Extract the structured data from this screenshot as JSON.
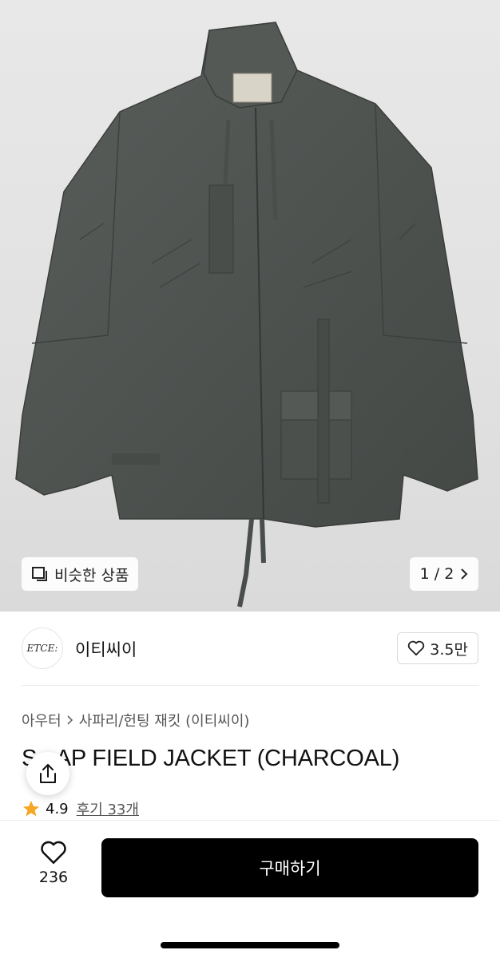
{
  "product_image": {
    "similar_label": "비슷한 상품",
    "pager": "1 / 2"
  },
  "brand": {
    "logo_text": "ETCE:",
    "name": "이티씨이",
    "likes": "3.5만"
  },
  "breadcrumb": {
    "items": [
      "아우터",
      "사파리/헌팅 재킷 (이티씨이)"
    ]
  },
  "product": {
    "title": "S...AP FIELD JACKET (CHARCOAL)",
    "rating": "4.9",
    "reviews": "후기 33개"
  },
  "bottom_bar": {
    "wish_count": "236",
    "buy_label": "구매하기"
  },
  "colors": {
    "jacket": "#4f5350",
    "buy_button": "#000000",
    "star": "#f5a623"
  },
  "icons": [
    "similar-products-icon",
    "chevron-right-icon",
    "heart-icon",
    "share-icon",
    "star-icon"
  ]
}
